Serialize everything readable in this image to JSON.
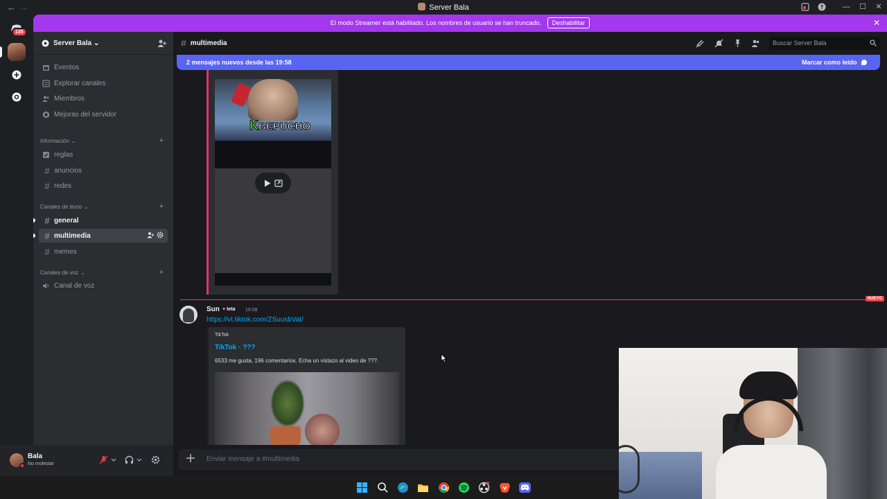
{
  "window": {
    "title": "Server Bala",
    "back": "←",
    "forward": "→",
    "minimize": "—",
    "maximize": "☐",
    "close": "✕"
  },
  "rail": {
    "home_badge": "135"
  },
  "banner": {
    "text": "El modo Streamer está habilitado. Los nombres de usuario se han truncado.",
    "button": "Deshabilitar",
    "close": "✕"
  },
  "sidebar": {
    "server_name": "Server Bala",
    "chevron": "⌄",
    "top_items": [
      {
        "label": "Eventos",
        "icon": "calendar-icon"
      },
      {
        "label": "Explorar canales",
        "icon": "browse-icon"
      },
      {
        "label": "Miembros",
        "icon": "members-icon"
      },
      {
        "label": "Mejoras del servidor",
        "icon": "boost-icon"
      }
    ],
    "categories": [
      {
        "label": "Información",
        "channels": [
          {
            "label": "reglas",
            "icon": "rules-icon"
          },
          {
            "label": "anuncios",
            "icon": "hash-icon"
          },
          {
            "label": "redes",
            "icon": "hash-icon"
          }
        ]
      },
      {
        "label": "Canales de texto",
        "channels": [
          {
            "label": "general",
            "icon": "hash-icon",
            "state": "unread"
          },
          {
            "label": "multimedia",
            "icon": "hash-icon",
            "state": "active"
          },
          {
            "label": "memes",
            "icon": "hash-icon"
          }
        ]
      },
      {
        "label": "Canales de voz",
        "channels": [
          {
            "label": "Canal de voz",
            "icon": "speaker-icon"
          }
        ]
      }
    ],
    "plus": "+",
    "hash": "#"
  },
  "user": {
    "name": "Bala",
    "status": "No molestar",
    "status_color": "#f23f43"
  },
  "header": {
    "hash": "#",
    "channel": "multimedia",
    "search_placeholder": "Buscar Server Bala"
  },
  "new_messages": {
    "text": "2 mensajes nuevos desde las 19:58",
    "action": "Marcar como leído"
  },
  "messages": {
    "embed1_thumb_text": "BEPUCHO",
    "embed1_thumb_letter": "K",
    "divider_label": "NUEVO",
    "msg": {
      "author": "Sun",
      "tag": "teta",
      "tag_heart": "♥",
      "time": "19:58",
      "link": "https://vt.tiktok.com/ZSuusbVat/",
      "embed": {
        "provider": "TikTok",
        "title": "TikTok · ???",
        "description": "6533 me gusta, 196 comentarios. Echa un vistazo al video de ???."
      }
    }
  },
  "composer": {
    "placeholder": "Enviar mensaje a #multimedia"
  },
  "colors": {
    "banner": "#a338ec",
    "new_bar": "#5865f2",
    "accent_red": "#f23f43",
    "link": "#00a8fc"
  }
}
